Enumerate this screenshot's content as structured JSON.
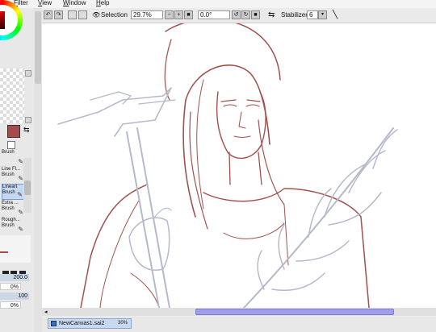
{
  "menubar": {
    "items": [
      {
        "label": "r",
        "accel": ""
      },
      {
        "label": "Filter",
        "accel": "F"
      },
      {
        "label": "View",
        "accel": "V"
      },
      {
        "label": "Window",
        "accel": "W"
      },
      {
        "label": "Help",
        "accel": "H"
      }
    ]
  },
  "toolbar": {
    "selection_label": "Selection",
    "zoom_value": "29.7%",
    "rotation_value": "0.0°",
    "stabilizer_label": "Stabilizer",
    "stabilizer_value": "6"
  },
  "tools": [
    {
      "name": "Brush",
      "label_line1": "",
      "label_line2": "Brush"
    },
    {
      "name": "Line Fl...",
      "label_line1": "Line Fl...",
      "label_line2": "Brush"
    },
    {
      "name": "Lineart",
      "label_line1": "Lineart",
      "label_line2": "Brush"
    },
    {
      "name": "Extra ...",
      "label_line1": "Extra ...",
      "label_line2": "Brush"
    },
    {
      "name": "Rough...",
      "label_line1": "Rough...",
      "label_line2": "Brush"
    }
  ],
  "brush_settings": {
    "size_value": "200.0",
    "min_size_value": "0%",
    "density_value": "100",
    "min_density_value": "0%"
  },
  "document_tab": {
    "name": "NewCanvas1.sai2",
    "zoom": "30%"
  },
  "colors": {
    "primary": "#a64b4b",
    "lineart": "#a3504c",
    "sketch": "#b6b9cc",
    "scroll_thumb": "#9f9ff0"
  }
}
